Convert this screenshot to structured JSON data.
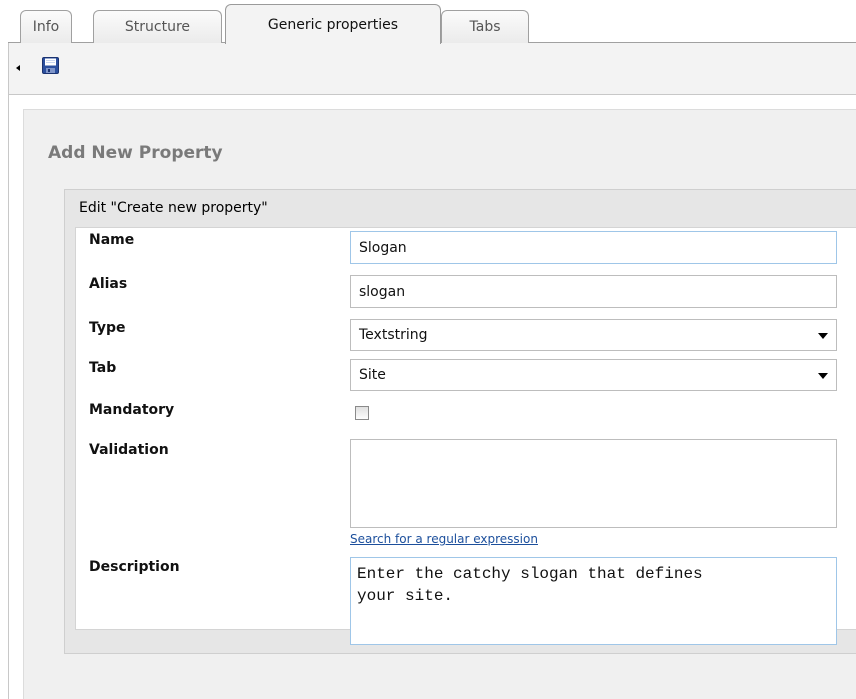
{
  "tabs": [
    {
      "label": "Info",
      "active": false
    },
    {
      "label": "Structure",
      "active": false
    },
    {
      "label": "Generic properties",
      "active": true
    },
    {
      "label": "Tabs",
      "active": false
    }
  ],
  "toolbar": {
    "save_icon": "floppy-disk-save-icon"
  },
  "panel": {
    "title": "Add New Property"
  },
  "form": {
    "header": "Edit \"Create new property\"",
    "name": {
      "label": "Name",
      "value": "Slogan"
    },
    "alias": {
      "label": "Alias",
      "value": "slogan"
    },
    "type": {
      "label": "Type",
      "value": "Textstring"
    },
    "tab": {
      "label": "Tab",
      "value": "Site"
    },
    "mandatory": {
      "label": "Mandatory",
      "checked": false
    },
    "validation": {
      "label": "Validation",
      "value": "",
      "link": "Search for a regular expression"
    },
    "description": {
      "label": "Description",
      "value": "Enter the catchy slogan that defines\nyour site."
    }
  },
  "colors": {
    "accent_link": "#1c4f9c",
    "focus_border": "#9fc6e8",
    "panel_bg": "#f0f0f0"
  }
}
